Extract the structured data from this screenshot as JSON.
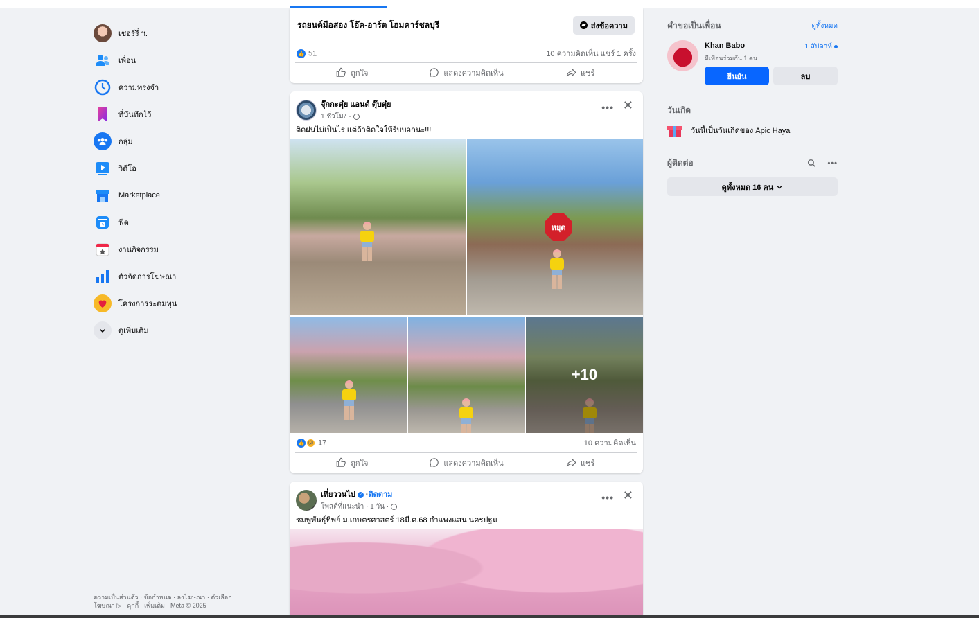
{
  "left_nav": {
    "items": [
      {
        "label": "เชอร์รี่ ฯ.",
        "icon": "user-avatar"
      },
      {
        "label": "เพื่อน",
        "icon": "friends-icon"
      },
      {
        "label": "ความทรงจำ",
        "icon": "memories-clock-icon"
      },
      {
        "label": "ที่บันทึกไว้",
        "icon": "bookmark-icon"
      },
      {
        "label": "กลุ่ม",
        "icon": "groups-icon"
      },
      {
        "label": "วิดีโอ",
        "icon": "video-icon"
      },
      {
        "label": "Marketplace",
        "icon": "marketplace-icon"
      },
      {
        "label": "ฟีด",
        "icon": "feeds-icon"
      },
      {
        "label": "งานกิจกรรม",
        "icon": "events-icon"
      },
      {
        "label": "ตัวจัดการโฆษณา",
        "icon": "ads-manager-icon"
      },
      {
        "label": "โครงการระดมทุน",
        "icon": "fundraisers-icon"
      },
      {
        "label": "ดูเพิ่มเติม",
        "icon": "chevron-down-icon"
      }
    ],
    "footer_line1": "ความเป็นส่วนตัว · ข้อกำหนด · ลงโฆษณา · ตัวเลือก",
    "footer_line2": "โฆษณา ▷ · คุกกี้ · เพิ่มเติม · Meta © 2025"
  },
  "feed": {
    "post1": {
      "title": "รถยนต์มือสอง โอ๊ค-อาร์ต โฮมคาร์ชลบุรี",
      "message_button": "ส่งข้อความ",
      "like_count": "51",
      "comments_shares": "10 ความคิดเห็น   แชร์ 1 ครั้ง"
    },
    "post2": {
      "author": "จุ๊กกะดุ๋ย แอนด์ ตุ๊บตุ๋ย",
      "time": "1 ชั่วโมง ·",
      "text": "ติดฝนไม่เป็นไร แต่ถ้าติดใจให้รีบบอกนะ!!!",
      "photo_sign": "หยุด",
      "more_photos": "+10",
      "reaction_count": "17",
      "comments": "10 ความคิดเห็น"
    },
    "post3": {
      "author": "เที่ยววนไป",
      "follow": "ติดตาม",
      "time": "โพสต์ที่แนะนำ · 1 วัน ·",
      "text": "ชมพูพันธุ์ทิพย์ ม.เกษตรศาสตร์ 18มี.ค.68 กำแพงแสน นครปฐม"
    },
    "actions": {
      "like": "ถูกใจ",
      "comment": "แสดงความคิดเห็น",
      "share": "แชร์"
    }
  },
  "right": {
    "friend_requests_title": "คำขอเป็นเพื่อน",
    "see_all": "ดูทั้งหมด",
    "request": {
      "name": "Khan Babo",
      "time": "1 สัปดาห์",
      "mutual": "มีเพื่อนร่วมกัน 1 คน",
      "confirm": "ยืนยัน",
      "delete": "ลบ"
    },
    "birthdays_title": "วันเกิด",
    "birthday_text": "วันนี้เป็นวันเกิดของ Apic Haya",
    "contacts_title": "ผู้ติดต่อ",
    "see_all_contacts": "ดูทั้งหมด 16 คน"
  },
  "colors": {
    "accent": "#1877f2",
    "confirm": "#0866ff",
    "background": "#f0f2f5"
  }
}
